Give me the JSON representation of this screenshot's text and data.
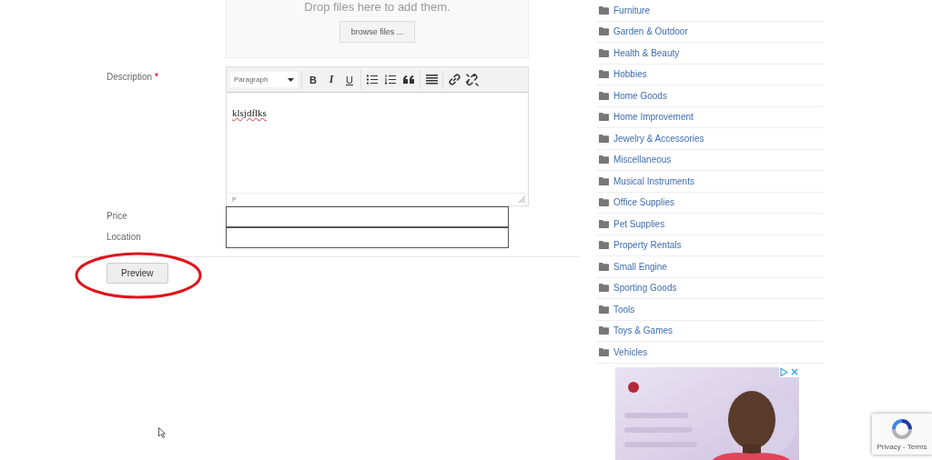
{
  "upload": {
    "hint": "Drop files here to add them.",
    "browse_button": "browse files ..."
  },
  "description": {
    "label": "Description",
    "required_mark": "*",
    "editor": {
      "format_select": "Paragraph",
      "toolbar": [
        [
          {
            "kind": "bold",
            "label": "B"
          },
          {
            "kind": "italic",
            "label": "I"
          },
          {
            "kind": "underline",
            "label": "U"
          }
        ],
        [
          {
            "kind": "bullet-list"
          },
          {
            "kind": "numbered-list"
          },
          {
            "kind": "blockquote"
          }
        ],
        [
          {
            "kind": "horizontal-rule"
          }
        ],
        [
          {
            "kind": "link"
          },
          {
            "kind": "unlink"
          }
        ]
      ],
      "content": "klsjdflks",
      "path": "P"
    }
  },
  "fields": [
    {
      "label": "Price"
    },
    {
      "label": "Location"
    }
  ],
  "preview_button": "Preview",
  "categories": [
    "Furniture",
    "Garden & Outdoor",
    "Health & Beauty",
    "Hobbies",
    "Home Goods",
    "Home Improvement",
    "Jewelry & Accessories",
    "Miscellaneous",
    "Musical Instruments",
    "Office Supplies",
    "Pet Supplies",
    "Property Rentals",
    "Small Engine",
    "Sporting Goods",
    "Tools",
    "Toys & Games",
    "Vehicles"
  ],
  "recaptcha": {
    "links": "Privacy - Terms"
  }
}
